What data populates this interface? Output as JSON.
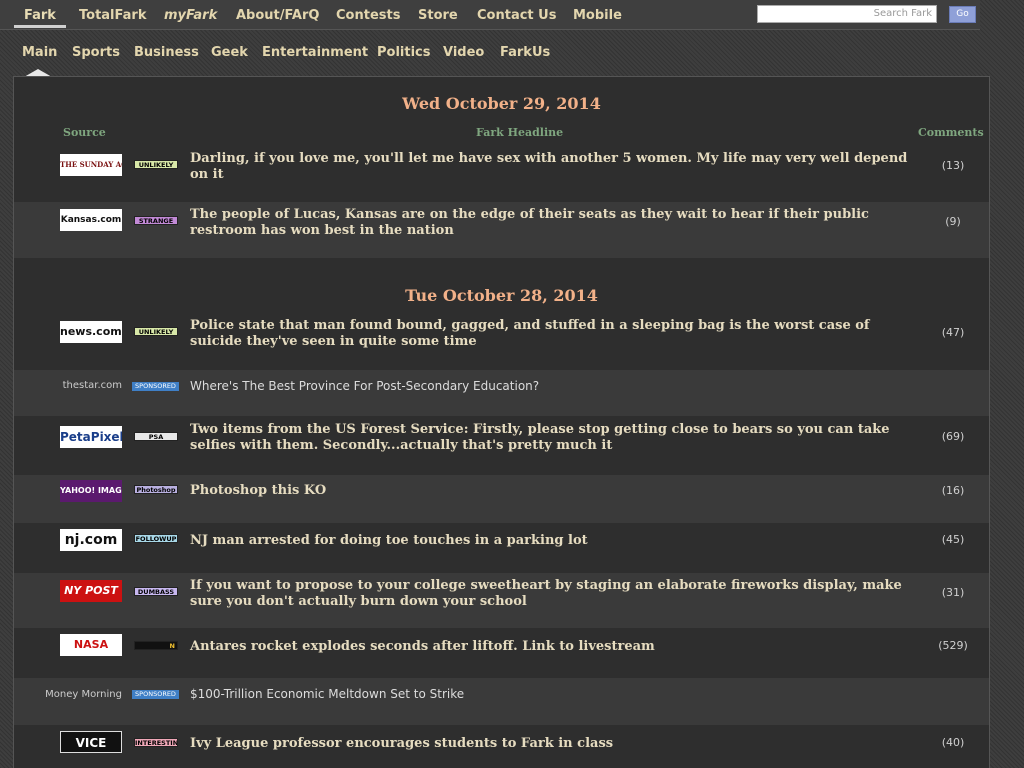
{
  "topnav": {
    "items": [
      "Fark",
      "TotalFark",
      "myFark",
      "About/FArQ",
      "Contests",
      "Store",
      "Contact Us",
      "Mobile"
    ],
    "search_placeholder": "Search Fark",
    "go_label": "Go"
  },
  "subnav": {
    "items": [
      "Main",
      "Sports",
      "Business",
      "Geek",
      "Entertainment",
      "Politics",
      "Video",
      "FarkUs"
    ]
  },
  "columns": {
    "source": "Source",
    "headline": "Fark Headline",
    "comments": "Comments"
  },
  "dates": [
    "Wed October 29, 2014",
    "Tue October 28, 2014"
  ],
  "rows": [
    {
      "source": "THE SUNDAY AGE",
      "tag": "UNLIKELY",
      "tag_color": "#d8e8a8",
      "headline": "Darling, if you love me, you'll let me have sex with another 5 women. My life may very well depend on it",
      "comments": "(13)"
    },
    {
      "source": "Kansas.com",
      "tag": "STRANGE",
      "tag_color": "#c28ad6",
      "headline": "The people of Lucas, Kansas are on the edge of their seats as they wait to hear if their public restroom has won best in the nation",
      "comments": "(9)"
    },
    {
      "source": "news.com.au",
      "tag": "UNLIKELY",
      "tag_color": "#d8e8a8",
      "headline": "Police state that man found bound, gagged, and stuffed in a sleeping bag is the worst case of suicide they've seen in quite some time",
      "comments": "(47)"
    },
    {
      "sponsored": true,
      "source": "thestar.com",
      "tag": "SPONSORED",
      "headline": "Where's The Best Province For Post-Secondary Education?"
    },
    {
      "source": "PetaPixel",
      "tag": "PSA",
      "tag_color": "#e8e8e8",
      "headline": "Two items from the US Forest Service: Firstly, please stop getting close to bears so you can take selfies with them. Secondly...actually that's pretty much it",
      "comments": "(69)"
    },
    {
      "source": "YAHOO! IMAGES",
      "tag": "Photoshop",
      "tag_color": "#b9b0e0",
      "headline": "Photoshop this KO",
      "comments": "(16)"
    },
    {
      "source": "nj.com",
      "tag": "FOLLOWUP",
      "tag_color": "#a8d8e8",
      "headline": "NJ man arrested for doing toe touches in a parking lot",
      "comments": "(45)"
    },
    {
      "source": "NY POST",
      "tag": "DUMBASS",
      "tag_color": "#c8b8f0",
      "headline": "If you want to propose to your college sweetheart by staging an elaborate fireworks display, make sure you don't actually burn down your school",
      "comments": "(31)"
    },
    {
      "source": "NASA",
      "tag": "N",
      "tag_color": "#111111",
      "headline": "Antares rocket explodes seconds after liftoff. Link to livestream",
      "comments": "(529)"
    },
    {
      "sponsored": true,
      "source": "Money Morning",
      "tag": "SPONSORED",
      "headline": "$100-Trillion Economic Meltdown Set to Strike"
    },
    {
      "source": "VICE",
      "tag": "INTERESTING",
      "tag_color": "#f0a8b8",
      "headline": "Ivy League professor encourages students to Fark in class",
      "comments": "(40)"
    }
  ]
}
